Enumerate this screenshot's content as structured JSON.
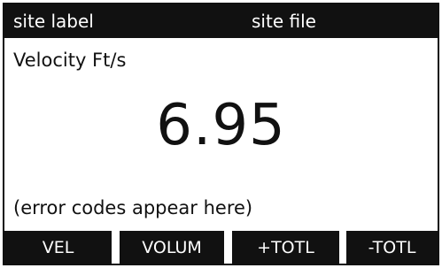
{
  "header": {
    "site_label": "site label",
    "site_file": "site file"
  },
  "measurement": {
    "label": "Velocity Ft/s",
    "value": "6.95"
  },
  "status": {
    "error_text": "(error codes appear here)"
  },
  "softkeys": [
    {
      "label": "VEL"
    },
    {
      "label": "VOLUM"
    },
    {
      "label": "+TOTL"
    },
    {
      "label": "-TOTL"
    }
  ]
}
